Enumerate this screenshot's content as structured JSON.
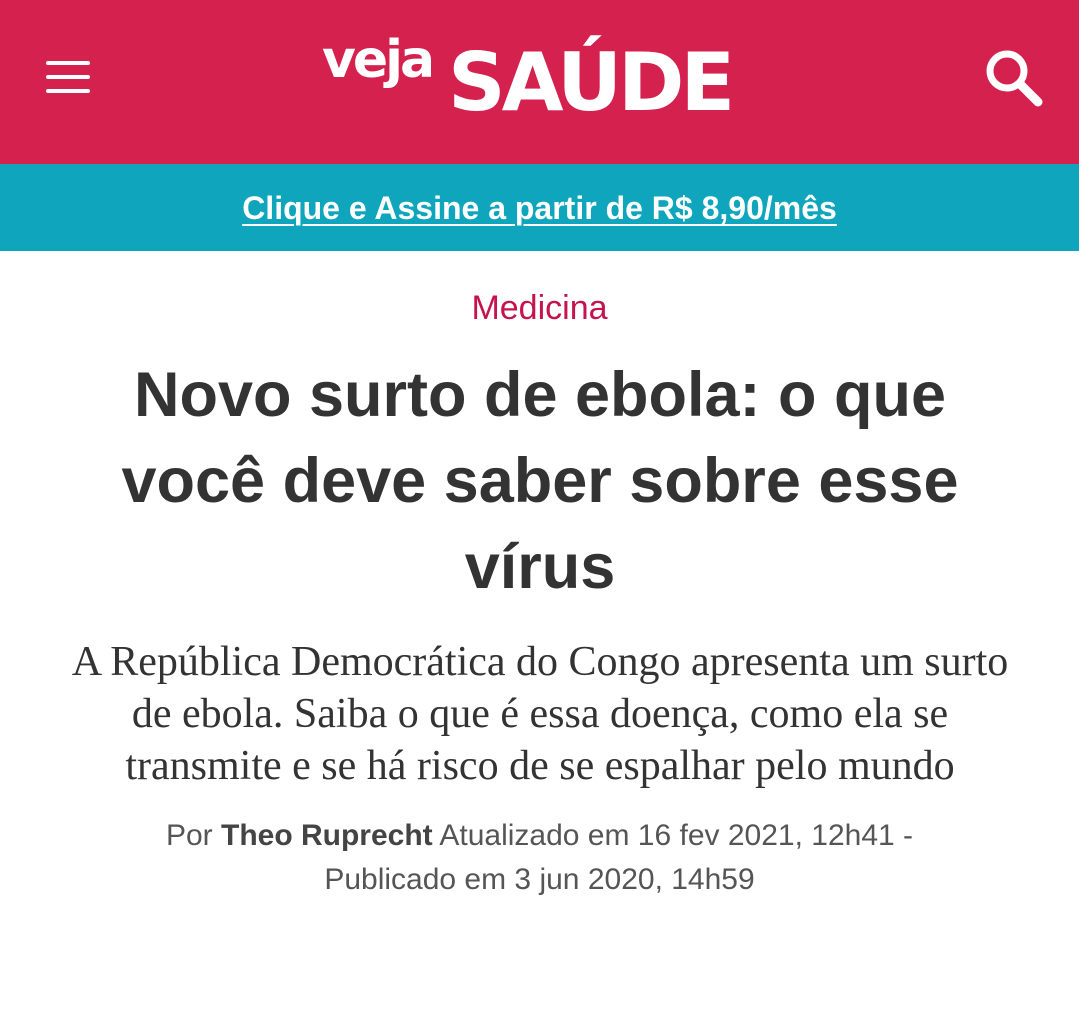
{
  "header": {
    "brand_prefix": "veja",
    "brand_name": "SAÚDE",
    "background": "#d4214e",
    "icons": [
      "hamburger-menu-icon",
      "search-icon"
    ]
  },
  "promo": {
    "link_text": "Clique e Assine a partir de R$ 8,90/mês",
    "background": "#0fa6bd"
  },
  "article": {
    "category": "Medicina",
    "category_color": "#c4134d",
    "title": "Novo surto de ebola: o que você deve saber sobre esse vírus",
    "subtitle": "A República Democrática do Congo apresenta um surto de ebola. Saiba o que é essa doença, como ela se transmite e se há risco de se espalhar pelo mundo",
    "byline": {
      "prefix": "Por",
      "author": "Theo Ruprecht",
      "updated": "Atualizado em 16 fev 2021, 12h41 -",
      "published": "Publicado em 3 jun 2020, 14h59"
    }
  }
}
